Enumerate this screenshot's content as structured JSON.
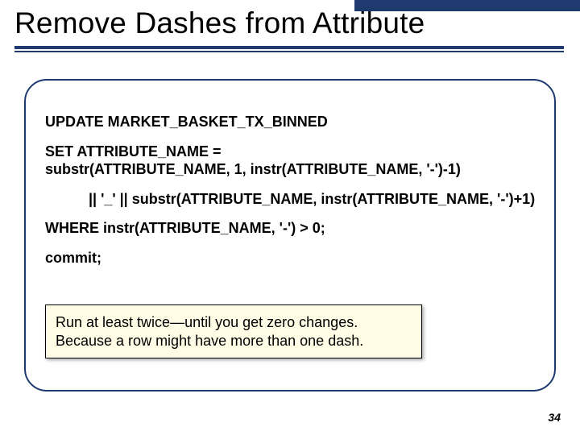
{
  "title": "Remove Dashes from Attribute",
  "sql": {
    "line1": "UPDATE MARKET_BASKET_TX_BINNED",
    "set1": "SET ATTRIBUTE_NAME =",
    "set2": "substr(ATTRIBUTE_NAME, 1, instr(ATTRIBUTE_NAME, '-')-1)",
    "concat": "|| '_' || substr(ATTRIBUTE_NAME, instr(ATTRIBUTE_NAME, '-')+1)",
    "where": "WHERE instr(ATTRIBUTE_NAME, '-') > 0;",
    "commit": "commit;"
  },
  "note": {
    "line1": "Run at least twice—until you get zero changes.",
    "line2": "Because a row might have more than one dash."
  },
  "page_number": "34"
}
